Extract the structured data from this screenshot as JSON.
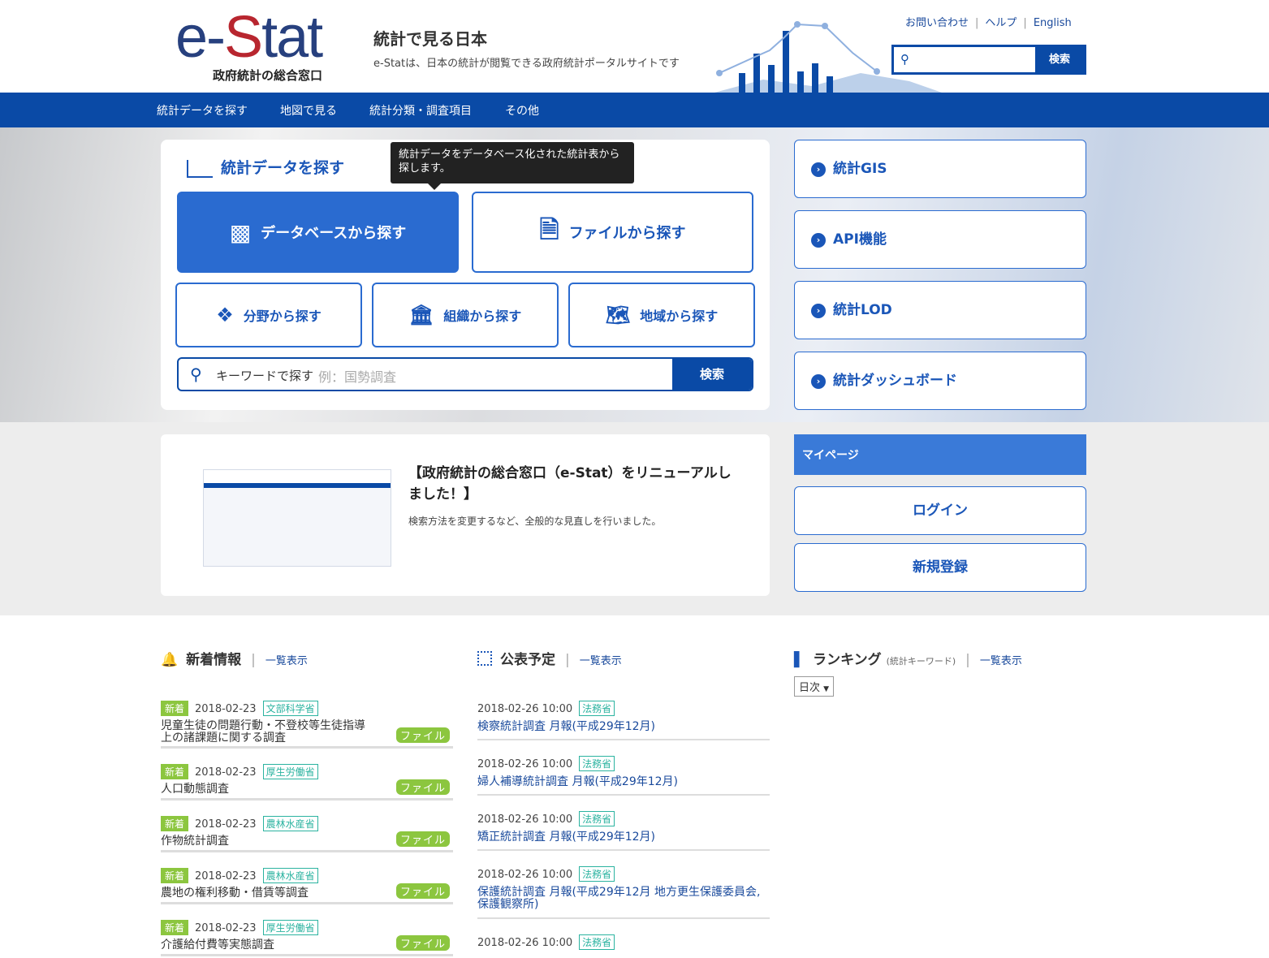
{
  "header": {
    "logo_main_e": "e-",
    "logo_main_s": "S",
    "logo_main_tat": "tat",
    "logo_sub": "政府統計の総合窓口",
    "title": "統計で見る日本",
    "description": "e-Statは、日本の統計が閲覧できる政府統計ポータルサイトです",
    "links": [
      "お問い合わせ",
      "ヘルプ",
      "English"
    ],
    "search_button": "検索",
    "search_value": ""
  },
  "nav": [
    "統計データを探す",
    "地図で見る",
    "統計分類・調査項目",
    "その他"
  ],
  "panel": {
    "title": "統計データを探す",
    "tooltip": "統計データをデータベース化された統計表から探します。",
    "db_button": "データベースから探す",
    "file_button": "ファイルから探す",
    "field_button": "分野から探す",
    "org_button": "組織から探す",
    "region_button": "地域から探す",
    "keyword_label": "キーワードで探す",
    "keyword_placeholder": "例：国勢調査",
    "keyword_button": "検索"
  },
  "side": [
    "統計GIS",
    "API機能",
    "統計LOD",
    "統計ダッシュボード"
  ],
  "news_banner": {
    "title": "【政府統計の総合窓口（e-Stat）をリニューアルしました！】",
    "text": "検索方法を変更するなど、全般的な見直しを行いました。"
  },
  "mypage": {
    "title": "マイページ",
    "login": "ログイン",
    "register": "新規登録"
  },
  "new_info": {
    "title": "新着情報",
    "list_link": "一覧表示",
    "items": [
      {
        "badge": "新着",
        "date": "2018-02-23",
        "org": "文部科学省",
        "title": "児童生徒の問題行動・不登校等生徒指導上の諸課題に関する調査",
        "tag": "ファイル"
      },
      {
        "badge": "新着",
        "date": "2018-02-23",
        "org": "厚生労働省",
        "title": "人口動態調査",
        "tag": "ファイル"
      },
      {
        "badge": "新着",
        "date": "2018-02-23",
        "org": "農林水産省",
        "title": "作物統計調査",
        "tag": "ファイル"
      },
      {
        "badge": "新着",
        "date": "2018-02-23",
        "org": "農林水産省",
        "title": "農地の権利移動・借賃等調査",
        "tag": "ファイル"
      },
      {
        "badge": "新着",
        "date": "2018-02-23",
        "org": "厚生労働省",
        "title": "介護給付費等実態調査",
        "tag": "ファイル"
      }
    ]
  },
  "schedule": {
    "title": "公表予定",
    "list_link": "一覧表示",
    "items": [
      {
        "date": "2018-02-26 10:00",
        "org": "法務省",
        "title": "検察統計調査 月報(平成29年12月)"
      },
      {
        "date": "2018-02-26 10:00",
        "org": "法務省",
        "title": "婦人補導統計調査 月報(平成29年12月)"
      },
      {
        "date": "2018-02-26 10:00",
        "org": "法務省",
        "title": "矯正統計調査 月報(平成29年12月)"
      },
      {
        "date": "2018-02-26 10:00",
        "org": "法務省",
        "title": "保護統計調査 月報(平成29年12月 地方更生保護委員会,保護観察所)"
      },
      {
        "date": "2018-02-26 10:00",
        "org": "法務省",
        "title": ""
      }
    ]
  },
  "ranking": {
    "title": "ランキング",
    "subtitle": "(統計キーワード)",
    "list_link": "一覧表示",
    "period": "日次"
  }
}
